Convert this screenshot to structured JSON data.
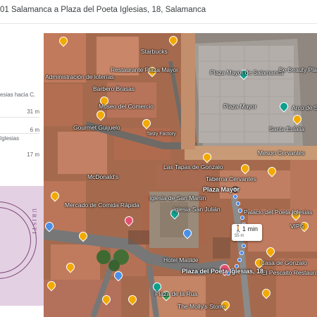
{
  "header": {
    "route_title": "01 Salamanca a Plaza del Poeta Iglesias, 18, Salamanca"
  },
  "directions": {
    "steps": [
      {
        "text": "esias hacia C.",
        "distance": "31 m"
      },
      {
        "text": "",
        "distance": "6 m"
      },
      {
        "text": "Iglesias",
        "distance": "17 m"
      }
    ]
  },
  "hotel_card": {
    "partial_text": "URISTI"
  },
  "map": {
    "route_duration": "1 min",
    "route_distance": "55 m",
    "walk_icon": "walking-person-icon",
    "labels": {
      "plaza_mayor_salamanca": "Plaza Mayor de Salamanca",
      "plaza_mayor": "Plaza Mayor",
      "plaza_mayor_street": "Plaza Mayor",
      "be_beauty": "Be Beauty Plaza de",
      "arco": "Arco de S",
      "santa_eulalia": "Santa Eulalia",
      "starbucks": "Starbucks",
      "restaurante": "Restaurante Plaza Mayor",
      "administracion": "Administración de loterías",
      "barbero": "Barbero Brasas",
      "museo": "Museo del Comercio",
      "gourmet": "Gourmet Guijuelo",
      "tasty_factory": "Tasty Factory",
      "tapas_gonzalo": "Las Tapas de Gonzalo",
      "taberna_cervantes": "Taberna Cervantes",
      "meson_cervantes": "Meson Cervantes",
      "mcdonalds": "McDonald's",
      "mercado": "Mercado de Comida Rápida",
      "iglesia_san_martin": "Iglesia de San Martín",
      "iglesia_san_julian": "Iglesia San Julián",
      "palacio": "Palacio del Poeta Iglesias",
      "vips": "VIPS",
      "casa_gonzalo": "Casa de Gonzalo",
      "pescaito": "El Pescaito Restaurante",
      "hotel_matilde": "Hotel Matilde",
      "destination": "Plaza del Poeta Iglesias, 18",
      "plaza_la_rua": "Plaza de la Rua",
      "molly": "The Molly's Stone"
    }
  }
}
